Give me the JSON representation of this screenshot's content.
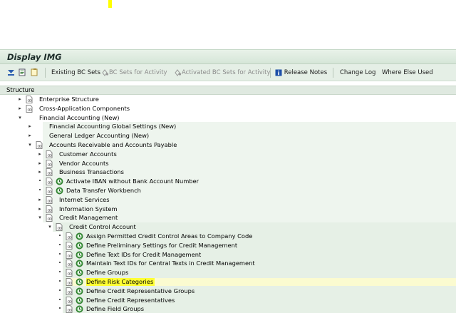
{
  "window": {
    "title": "Display IMG"
  },
  "toolbar": {
    "existing_bc_sets": "Existing BC Sets",
    "bc_sets_for_activity": "BC Sets for Activity",
    "activated_bc_sets_for_activity": "Activated BC Sets for Activity",
    "release_notes": "Release Notes",
    "change_log": "Change Log",
    "where_else_used": "Where Else Used"
  },
  "structure": {
    "label": "Structure"
  },
  "tree": [
    {
      "label": "Enterprise Structure",
      "level": 0,
      "caret": "collapsed",
      "clock": false
    },
    {
      "label": "Cross-Application Components",
      "level": 0,
      "caret": "collapsed",
      "clock": false
    },
    {
      "label": "Financial Accounting (New)",
      "level": 0,
      "caret": "expanded",
      "clock": false,
      "nodoc": true
    },
    {
      "label": "Financial Accounting Global Settings (New)",
      "level": 1,
      "caret": "collapsed",
      "clock": false,
      "nodoc": true
    },
    {
      "label": "General Ledger Accounting (New)",
      "level": 1,
      "caret": "collapsed",
      "clock": false,
      "nodoc": true
    },
    {
      "label": "Accounts Receivable and Accounts Payable",
      "level": 1,
      "caret": "expanded",
      "clock": false
    },
    {
      "label": "Customer Accounts",
      "level": 2,
      "caret": "collapsed",
      "clock": false
    },
    {
      "label": "Vendor Accounts",
      "level": 2,
      "caret": "collapsed",
      "clock": false
    },
    {
      "label": "Business Transactions",
      "level": 2,
      "caret": "collapsed",
      "clock": false
    },
    {
      "label": "Activate IBAN without Bank Account Number",
      "level": 2,
      "caret": "leaf",
      "clock": true
    },
    {
      "label": "Data Transfer Workbench",
      "level": 2,
      "caret": "leaf",
      "clock": true
    },
    {
      "label": "Internet Services",
      "level": 2,
      "caret": "collapsed",
      "clock": false
    },
    {
      "label": "Information System",
      "level": 2,
      "caret": "collapsed",
      "clock": false
    },
    {
      "label": "Credit Management",
      "level": 2,
      "caret": "expanded",
      "clock": false
    },
    {
      "label": "Credit Control Account",
      "level": 3,
      "caret": "expanded",
      "clock": false
    },
    {
      "label": "Assign Permitted Credit Control Areas to Company Code",
      "level": 4,
      "caret": "leaf",
      "clock": true
    },
    {
      "label": "Define Preliminary Settings for Credit Management",
      "level": 4,
      "caret": "leaf",
      "clock": true
    },
    {
      "label": "Define Text IDs for Credit Management",
      "level": 4,
      "caret": "leaf",
      "clock": true
    },
    {
      "label": "Maintain Text IDs for Central Texts in Credit Management",
      "level": 4,
      "caret": "leaf",
      "clock": true
    },
    {
      "label": "Define Groups",
      "level": 4,
      "caret": "leaf",
      "clock": true
    },
    {
      "label": "Define Risk Categories",
      "level": 4,
      "caret": "leaf",
      "clock": true,
      "highlighted": true
    },
    {
      "label": "Define Credit Representative Groups",
      "level": 4,
      "caret": "leaf",
      "clock": true
    },
    {
      "label": "Define Credit Representatives",
      "level": 4,
      "caret": "leaf",
      "clock": true
    },
    {
      "label": "Define Field Groups",
      "level": 4,
      "caret": "leaf",
      "clock": true
    }
  ],
  "colors": {
    "highlight": "#ffff33",
    "band": "#eef5ee",
    "band_deep": "#e6f0e6"
  }
}
